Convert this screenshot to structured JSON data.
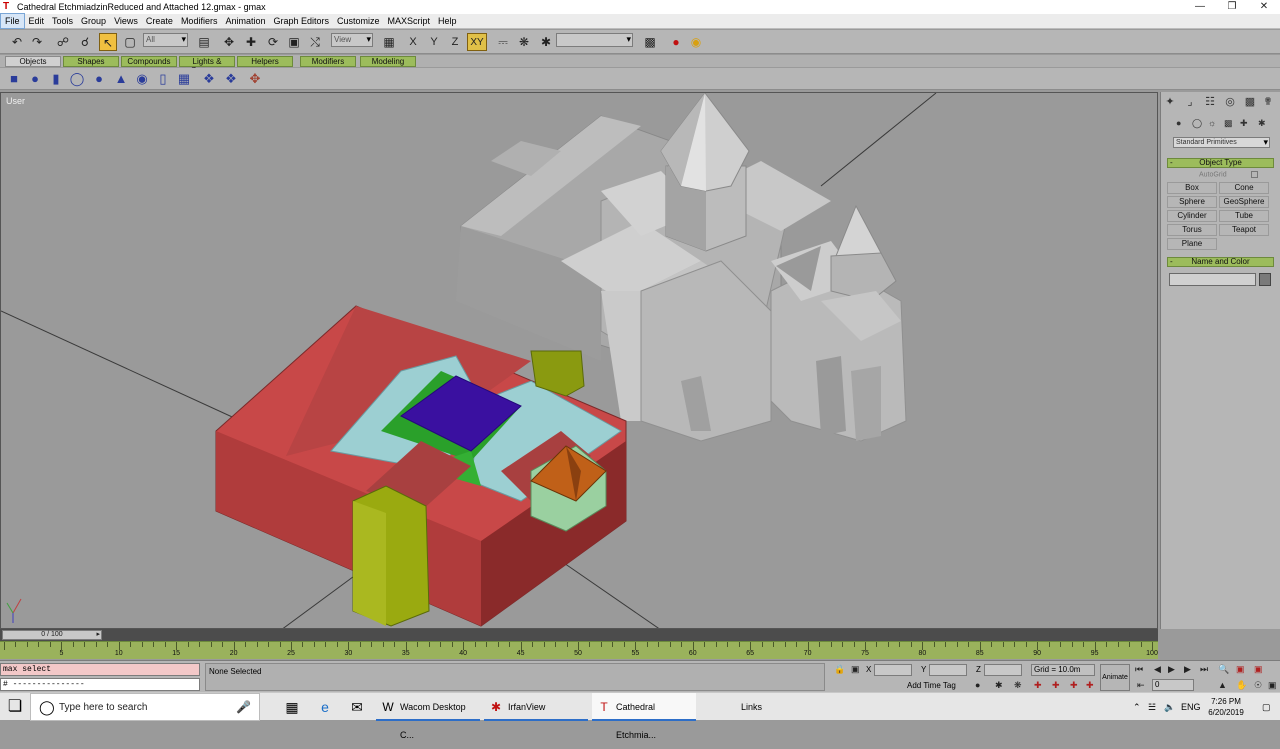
{
  "window": {
    "title": "Cathedral EtchmiadzinReduced and Attached 12.gmax - gmax",
    "min": "—",
    "max": "❐",
    "close": "✕"
  },
  "menu": [
    "File",
    "Edit",
    "Tools",
    "Group",
    "Views",
    "Create",
    "Modifiers",
    "Animation",
    "Graph Editors",
    "Customize",
    "MAXScript",
    "Help"
  ],
  "toolbar": {
    "selection_filter": "All",
    "ref_coord": "View",
    "named_selection": "",
    "axis_labels": [
      "X",
      "Y",
      "Z",
      "XY"
    ]
  },
  "tabs": [
    "Objects",
    "Shapes",
    "Compounds",
    "Lights & Cameras",
    "Helpers",
    "Modifiers",
    "Modeling"
  ],
  "viewport": {
    "label": "User"
  },
  "command_panel": {
    "category": "Standard Primitives",
    "object_type_title": "Object Type",
    "autogrid": "AutoGrid",
    "buttons": [
      "Box",
      "Cone",
      "Sphere",
      "GeoSphere",
      "Cylinder",
      "Tube",
      "Torus",
      "Teapot",
      "Plane"
    ],
    "name_color_title": "Name and Color",
    "rollout_minus": "-"
  },
  "timeslider": {
    "position": "0 / 100",
    "ticks": [
      5,
      10,
      15,
      20,
      25,
      30,
      35,
      40,
      45,
      50,
      55,
      60,
      65,
      70,
      75,
      80,
      85,
      90,
      95,
      100
    ]
  },
  "status": {
    "maxscript_input": "max select",
    "maxscript_output": "# ---------------",
    "message": "None Selected",
    "x_label": "X",
    "y_label": "Y",
    "z_label": "Z",
    "grid": "Grid = 10.0m",
    "add_time_tag": "Add Time Tag",
    "animate": "Animate",
    "frame": "0"
  },
  "taskbar": {
    "search_placeholder": "Type here to search",
    "apps": [
      "Wacom Desktop C...",
      "IrfanView",
      "Cathedral Etchmia..."
    ],
    "links": "Links",
    "lang": "ENG",
    "time": "7:26 PM",
    "date": "6/20/2019"
  }
}
